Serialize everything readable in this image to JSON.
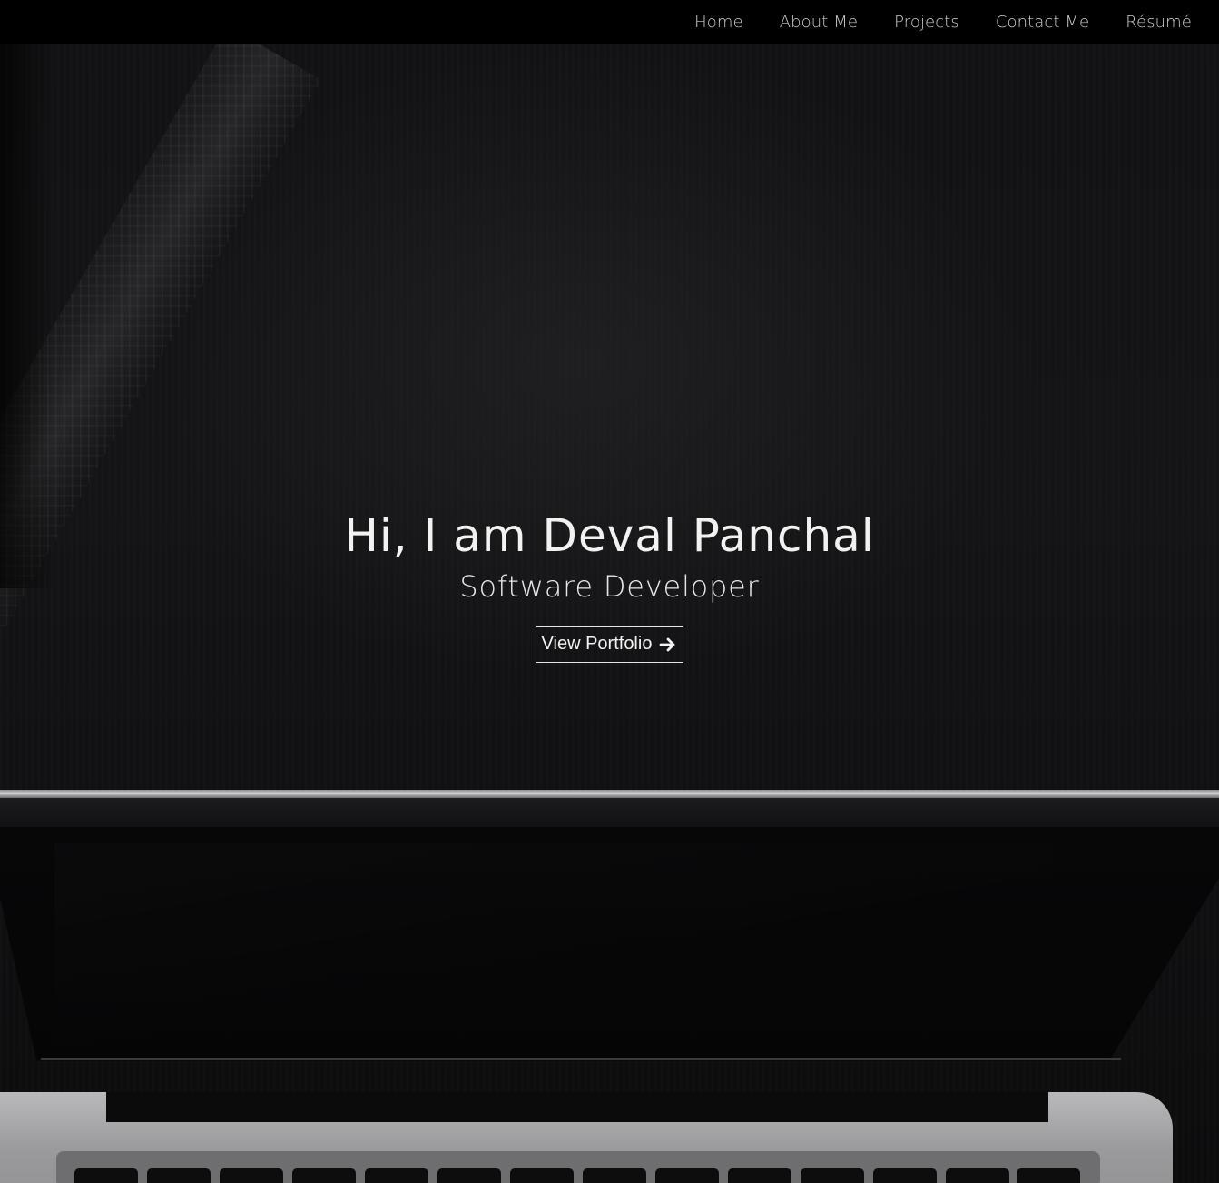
{
  "nav": {
    "links": [
      {
        "label": "Home"
      },
      {
        "label": "About Me"
      },
      {
        "label": "Projects"
      },
      {
        "label": "Contact Me"
      },
      {
        "label": "Résumé"
      }
    ]
  },
  "hero": {
    "title": "Hi, I am Deval Panchal",
    "subtitle": "Software Developer",
    "cta_label": "View Portfolio",
    "cta_icon": "arrow-right-icon"
  },
  "colors": {
    "nav_background": "#000000",
    "nav_text": "#cfcfcf",
    "hero_text": "#f2f2f2",
    "button_border": "#e6e6e6"
  }
}
